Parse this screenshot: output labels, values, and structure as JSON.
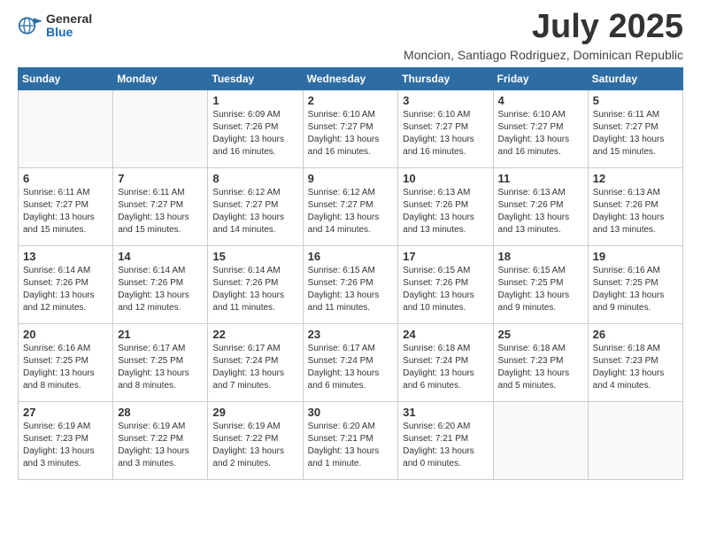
{
  "logo": {
    "general": "General",
    "blue": "Blue"
  },
  "title": {
    "month_year": "July 2025",
    "location": "Moncion, Santiago Rodriguez, Dominican Republic"
  },
  "weekdays": [
    "Sunday",
    "Monday",
    "Tuesday",
    "Wednesday",
    "Thursday",
    "Friday",
    "Saturday"
  ],
  "weeks": [
    [
      {
        "day": null,
        "detail": null
      },
      {
        "day": null,
        "detail": null
      },
      {
        "day": "1",
        "detail": "Sunrise: 6:09 AM\nSunset: 7:26 PM\nDaylight: 13 hours and 16 minutes."
      },
      {
        "day": "2",
        "detail": "Sunrise: 6:10 AM\nSunset: 7:27 PM\nDaylight: 13 hours and 16 minutes."
      },
      {
        "day": "3",
        "detail": "Sunrise: 6:10 AM\nSunset: 7:27 PM\nDaylight: 13 hours and 16 minutes."
      },
      {
        "day": "4",
        "detail": "Sunrise: 6:10 AM\nSunset: 7:27 PM\nDaylight: 13 hours and 16 minutes."
      },
      {
        "day": "5",
        "detail": "Sunrise: 6:11 AM\nSunset: 7:27 PM\nDaylight: 13 hours and 15 minutes."
      }
    ],
    [
      {
        "day": "6",
        "detail": "Sunrise: 6:11 AM\nSunset: 7:27 PM\nDaylight: 13 hours and 15 minutes."
      },
      {
        "day": "7",
        "detail": "Sunrise: 6:11 AM\nSunset: 7:27 PM\nDaylight: 13 hours and 15 minutes."
      },
      {
        "day": "8",
        "detail": "Sunrise: 6:12 AM\nSunset: 7:27 PM\nDaylight: 13 hours and 14 minutes."
      },
      {
        "day": "9",
        "detail": "Sunrise: 6:12 AM\nSunset: 7:27 PM\nDaylight: 13 hours and 14 minutes."
      },
      {
        "day": "10",
        "detail": "Sunrise: 6:13 AM\nSunset: 7:26 PM\nDaylight: 13 hours and 13 minutes."
      },
      {
        "day": "11",
        "detail": "Sunrise: 6:13 AM\nSunset: 7:26 PM\nDaylight: 13 hours and 13 minutes."
      },
      {
        "day": "12",
        "detail": "Sunrise: 6:13 AM\nSunset: 7:26 PM\nDaylight: 13 hours and 13 minutes."
      }
    ],
    [
      {
        "day": "13",
        "detail": "Sunrise: 6:14 AM\nSunset: 7:26 PM\nDaylight: 13 hours and 12 minutes."
      },
      {
        "day": "14",
        "detail": "Sunrise: 6:14 AM\nSunset: 7:26 PM\nDaylight: 13 hours and 12 minutes."
      },
      {
        "day": "15",
        "detail": "Sunrise: 6:14 AM\nSunset: 7:26 PM\nDaylight: 13 hours and 11 minutes."
      },
      {
        "day": "16",
        "detail": "Sunrise: 6:15 AM\nSunset: 7:26 PM\nDaylight: 13 hours and 11 minutes."
      },
      {
        "day": "17",
        "detail": "Sunrise: 6:15 AM\nSunset: 7:26 PM\nDaylight: 13 hours and 10 minutes."
      },
      {
        "day": "18",
        "detail": "Sunrise: 6:15 AM\nSunset: 7:25 PM\nDaylight: 13 hours and 9 minutes."
      },
      {
        "day": "19",
        "detail": "Sunrise: 6:16 AM\nSunset: 7:25 PM\nDaylight: 13 hours and 9 minutes."
      }
    ],
    [
      {
        "day": "20",
        "detail": "Sunrise: 6:16 AM\nSunset: 7:25 PM\nDaylight: 13 hours and 8 minutes."
      },
      {
        "day": "21",
        "detail": "Sunrise: 6:17 AM\nSunset: 7:25 PM\nDaylight: 13 hours and 8 minutes."
      },
      {
        "day": "22",
        "detail": "Sunrise: 6:17 AM\nSunset: 7:24 PM\nDaylight: 13 hours and 7 minutes."
      },
      {
        "day": "23",
        "detail": "Sunrise: 6:17 AM\nSunset: 7:24 PM\nDaylight: 13 hours and 6 minutes."
      },
      {
        "day": "24",
        "detail": "Sunrise: 6:18 AM\nSunset: 7:24 PM\nDaylight: 13 hours and 6 minutes."
      },
      {
        "day": "25",
        "detail": "Sunrise: 6:18 AM\nSunset: 7:23 PM\nDaylight: 13 hours and 5 minutes."
      },
      {
        "day": "26",
        "detail": "Sunrise: 6:18 AM\nSunset: 7:23 PM\nDaylight: 13 hours and 4 minutes."
      }
    ],
    [
      {
        "day": "27",
        "detail": "Sunrise: 6:19 AM\nSunset: 7:23 PM\nDaylight: 13 hours and 3 minutes."
      },
      {
        "day": "28",
        "detail": "Sunrise: 6:19 AM\nSunset: 7:22 PM\nDaylight: 13 hours and 3 minutes."
      },
      {
        "day": "29",
        "detail": "Sunrise: 6:19 AM\nSunset: 7:22 PM\nDaylight: 13 hours and 2 minutes."
      },
      {
        "day": "30",
        "detail": "Sunrise: 6:20 AM\nSunset: 7:21 PM\nDaylight: 13 hours and 1 minute."
      },
      {
        "day": "31",
        "detail": "Sunrise: 6:20 AM\nSunset: 7:21 PM\nDaylight: 13 hours and 0 minutes."
      },
      {
        "day": null,
        "detail": null
      },
      {
        "day": null,
        "detail": null
      }
    ]
  ]
}
